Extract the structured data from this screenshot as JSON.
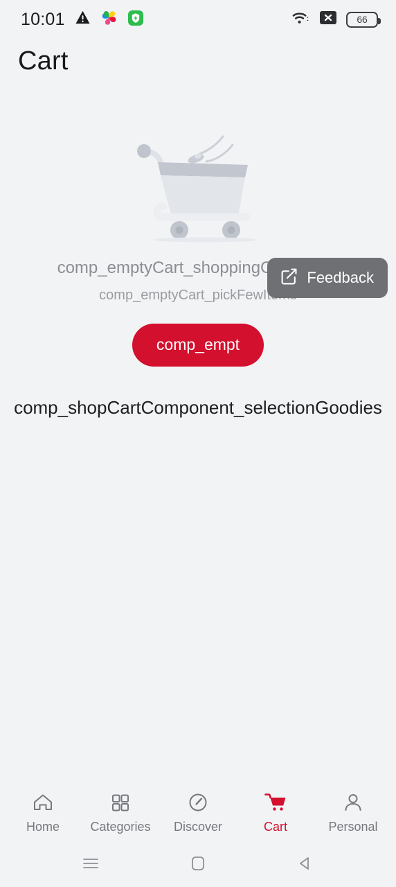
{
  "status_bar": {
    "time": "10:01",
    "left_icons": [
      {
        "name": "warning-icon"
      },
      {
        "name": "pinwheel-icon"
      },
      {
        "name": "green-shield-icon"
      }
    ],
    "right_icons": [
      {
        "name": "wifi-icon"
      },
      {
        "name": "no-signal-icon"
      }
    ],
    "battery_level": "66"
  },
  "header": {
    "title": "Cart"
  },
  "empty_cart": {
    "illustration": "empty-shopping-cart-illustration",
    "title": "comp_emptyCart_shoppingCartEmpty",
    "subtitle": "comp_emptyCart_pickFewItems",
    "button_label": "comp_empt"
  },
  "section": {
    "heading": "comp_shopCartComponent_selectionGoodies"
  },
  "feedback": {
    "label": "Feedback",
    "icon": "edit-square-icon"
  },
  "tab_bar": {
    "items": [
      {
        "label": "Home",
        "icon": "home-icon",
        "active": false
      },
      {
        "label": "Categories",
        "icon": "grid-icon",
        "active": false
      },
      {
        "label": "Discover",
        "icon": "compass-icon",
        "active": false
      },
      {
        "label": "Cart",
        "icon": "cart-icon",
        "active": true
      },
      {
        "label": "Personal",
        "icon": "person-icon",
        "active": false
      }
    ]
  },
  "nav_bar": {
    "buttons": [
      {
        "name": "recents-button",
        "icon": "menu-lines-icon"
      },
      {
        "name": "home-button",
        "icon": "square-icon"
      },
      {
        "name": "back-button",
        "icon": "triangle-left-icon"
      }
    ]
  },
  "colors": {
    "background": "#f2f3f5",
    "accent_red": "#d3102e",
    "feedback_gray": "#6e7073",
    "muted_text": "#8b8d93"
  }
}
